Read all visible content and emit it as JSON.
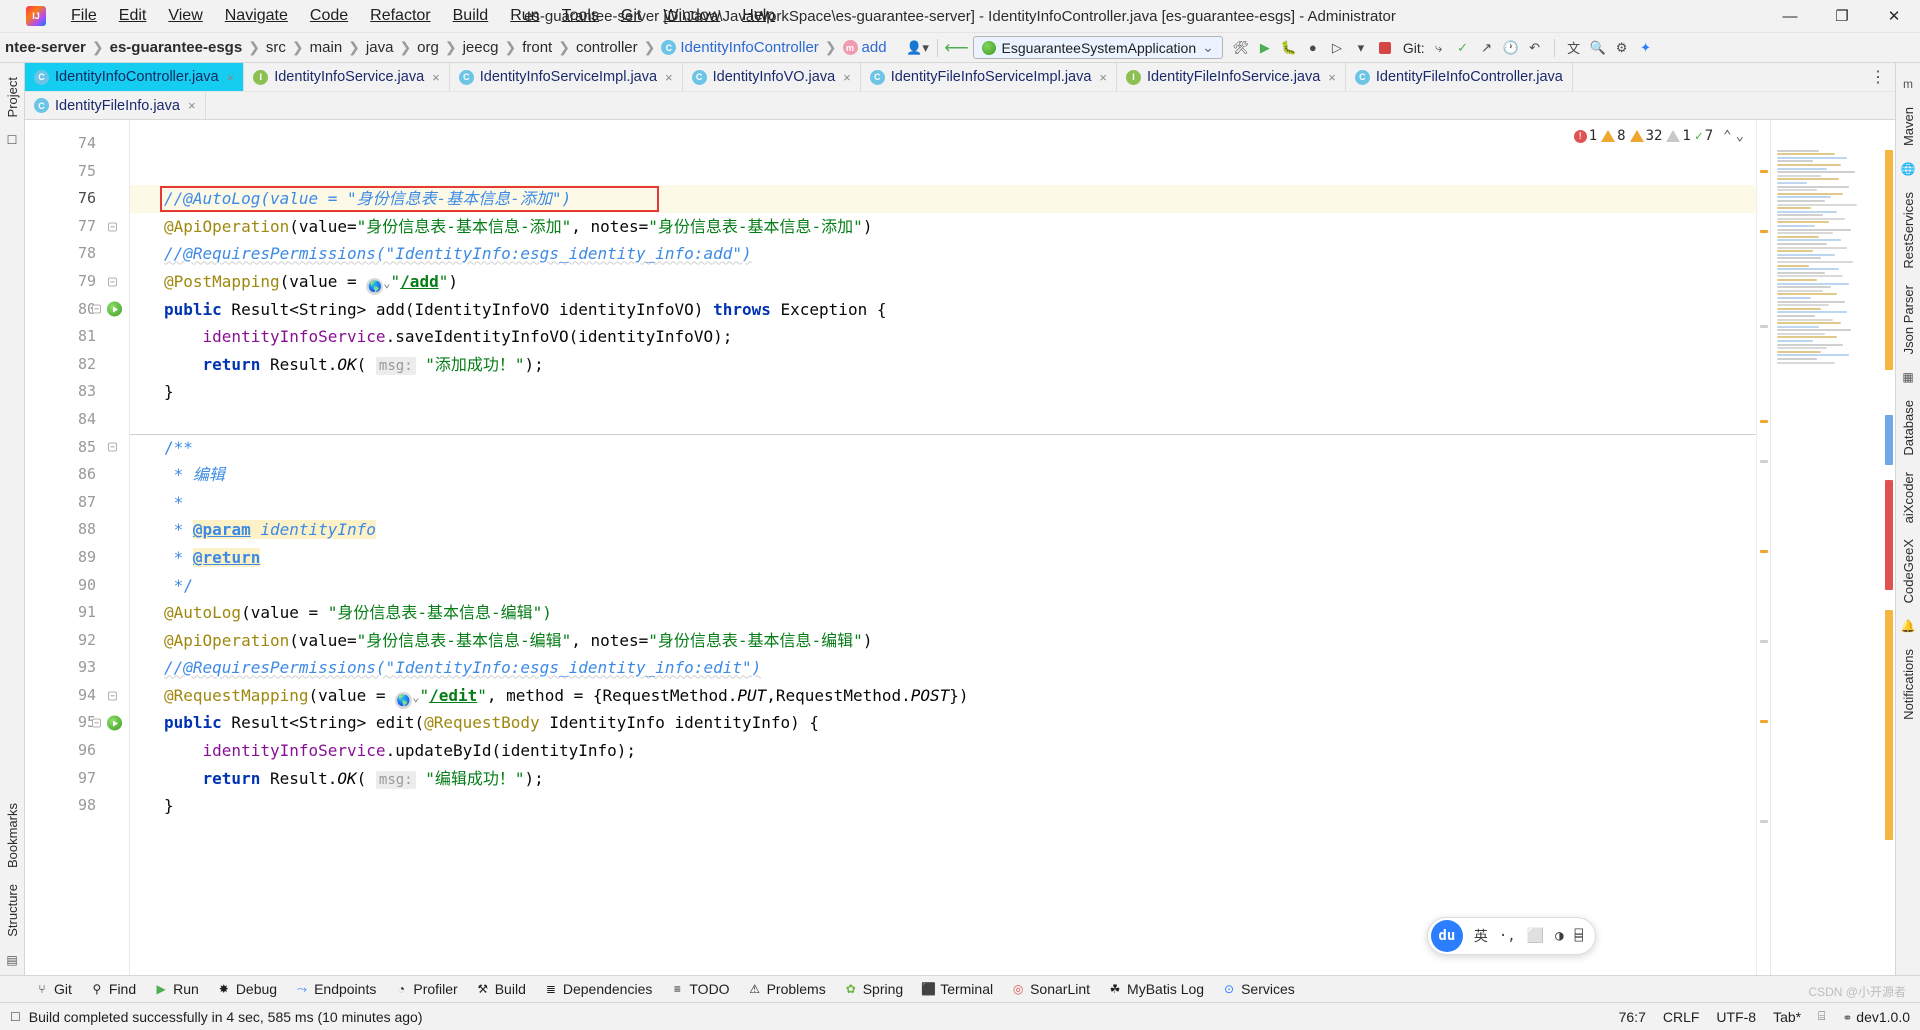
{
  "window": {
    "title": "es-guarantee-server [D:\\Java\\JavaWorkSpace\\es-guarantee-server] - IdentityInfoController.java [es-guarantee-esgs] - Administrator",
    "logo_label": "IJ",
    "minimize": "—",
    "maximize": "❐",
    "close": "✕"
  },
  "menubar": {
    "items": [
      {
        "label": "File"
      },
      {
        "label": "Edit"
      },
      {
        "label": "View"
      },
      {
        "label": "Navigate"
      },
      {
        "label": "Code"
      },
      {
        "label": "Refactor"
      },
      {
        "label": "Build"
      },
      {
        "label": "Run"
      },
      {
        "label": "Tools"
      },
      {
        "label": "Git"
      },
      {
        "label": "Window"
      },
      {
        "label": "Help"
      }
    ]
  },
  "navbar": {
    "crumbs": [
      {
        "label": "ntee-server",
        "bold": true,
        "icon": ""
      },
      {
        "label": "es-guarantee-esgs",
        "bold": true,
        "icon": ""
      },
      {
        "label": "src",
        "bold": false,
        "icon": ""
      },
      {
        "label": "main",
        "bold": false,
        "icon": ""
      },
      {
        "label": "java",
        "bold": false,
        "icon": ""
      },
      {
        "label": "org",
        "bold": false,
        "icon": ""
      },
      {
        "label": "jeecg",
        "bold": false,
        "icon": ""
      },
      {
        "label": "front",
        "bold": false,
        "icon": ""
      },
      {
        "label": "controller",
        "bold": false,
        "icon": ""
      },
      {
        "label": "IdentityInfoController",
        "bold": false,
        "icon": "class-icon",
        "icon_letter": "C"
      },
      {
        "label": "add",
        "bold": false,
        "icon": "method-icon",
        "icon_letter": "m"
      }
    ],
    "separator": "❯",
    "run_config": "EsguaranteeSystemApplication",
    "run_config_caret": "⌄",
    "git_label": "Git:"
  },
  "tabs": [
    {
      "label": "IdentityInfoController.java",
      "icon": "class-icon",
      "letter": "C",
      "active": true
    },
    {
      "label": "IdentityInfoService.java",
      "icon": "interface-icon",
      "letter": "I",
      "active": false
    },
    {
      "label": "IdentityInfoServiceImpl.java",
      "icon": "class-icon",
      "letter": "C",
      "active": false
    },
    {
      "label": "IdentityInfoVO.java",
      "icon": "class-icon",
      "letter": "C",
      "active": false
    },
    {
      "label": "IdentityFileInfoServiceImpl.java",
      "icon": "class-icon",
      "letter": "C",
      "active": false
    },
    {
      "label": "IdentityFileInfoService.java",
      "icon": "interface-icon",
      "letter": "I",
      "active": false
    },
    {
      "label": "IdentityFileInfoController.java",
      "icon": "class-icon",
      "letter": "C",
      "active": false
    }
  ],
  "tabs_row2": [
    {
      "label": "IdentityFileInfo.java",
      "icon": "class-icon",
      "letter": "C",
      "active": false
    }
  ],
  "tab_close_glyph": "×",
  "tabs_more_glyph": "⋮",
  "inspections": {
    "errors": "1",
    "warnings": "8",
    "weak_warnings": "32",
    "infos": "1",
    "typos": "7",
    "up_glyph": "⌃",
    "down_glyph": "⌄"
  },
  "editor": {
    "first_line": 74,
    "current_line": 76,
    "lines": [
      {
        "n": 74,
        "text": ""
      },
      {
        "n": 75,
        "text": ""
      },
      {
        "n": 76,
        "text": "//@AutoLog(value = \"身份信息表-基本信息-添加\")"
      },
      {
        "n": 77,
        "text": "@ApiOperation(value=\"身份信息表-基本信息-添加\", notes=\"身份信息表-基本信息-添加\")"
      },
      {
        "n": 78,
        "text": "//@RequiresPermissions(\"IdentityInfo:esgs_identity_info:add\")"
      },
      {
        "n": 79,
        "text": "@PostMapping(value = \"/add\")"
      },
      {
        "n": 80,
        "text": "public Result<String> add(IdentityInfoVO identityInfoVO) throws Exception {"
      },
      {
        "n": 81,
        "text": "    identityInfoService.saveIdentityInfoVO(identityInfoVO);"
      },
      {
        "n": 82,
        "text": "    return Result.OK( msg: \"添加成功！\");"
      },
      {
        "n": 83,
        "text": "}"
      },
      {
        "n": 84,
        "text": ""
      },
      {
        "n": 85,
        "text": "/**"
      },
      {
        "n": 86,
        "text": " * 编辑"
      },
      {
        "n": 87,
        "text": " *"
      },
      {
        "n": 88,
        "text": " * @param identityInfo"
      },
      {
        "n": 89,
        "text": " * @return"
      },
      {
        "n": 90,
        "text": " */"
      },
      {
        "n": 91,
        "text": "@AutoLog(value = \"身份信息表-基本信息-编辑\")"
      },
      {
        "n": 92,
        "text": "@ApiOperation(value=\"身份信息表-基本信息-编辑\", notes=\"身份信息表-基本信息-编辑\")"
      },
      {
        "n": 93,
        "text": "//@RequiresPermissions(\"IdentityInfo:esgs_identity_info:edit\")"
      },
      {
        "n": 94,
        "text": "@RequestMapping(value = \"/edit\", method = {RequestMethod.PUT,RequestMethod.POST})"
      },
      {
        "n": 95,
        "text": "public Result<String> edit(@RequestBody IdentityInfo identityInfo) {"
      },
      {
        "n": 96,
        "text": "    identityInfoService.updateById(identityInfo);"
      },
      {
        "n": 97,
        "text": "    return Result.OK( msg: \"编辑成功！\");"
      },
      {
        "n": 98,
        "text": "}"
      }
    ],
    "tokens": {
      "autolog_comment_prefix": "//@AutoLog(value = ",
      "autolog_comment_string": "\"身份信息表-基本信息-添加\")",
      "api_operation_name": "@ApiOperation",
      "api_value_key": "value=",
      "api_value_str": "\"身份信息表-基本信息-添加\"",
      "api_notes_key": "notes=",
      "api_notes_str": "\"身份信息表-基本信息-添加\"",
      "requires_permissions_add": "//@RequiresPermissions(\"IdentityInfo:esgs_identity_info:add\")",
      "post_mapping": "@PostMapping",
      "value_eq": "(value = ",
      "add_path": "\"/add\"",
      "add_path_inner": "/add",
      "kw_public": "public",
      "result_string": " Result<String> ",
      "method_add": "add(IdentityInfoVO identityInfoVO) ",
      "kw_throws": "throws",
      "exception_brace": " Exception {",
      "service_field": "identityInfoService",
      "save_call": ".saveIdentityInfoVO(identityInfoVO);",
      "kw_return": "return",
      "result_ok": " Result.",
      "ok_static": "OK",
      "paren_open": "( ",
      "msg_hint": "msg:",
      "add_success_str": " \"添加成功！\"",
      "semi_close": ");",
      "brace_close": "}",
      "jdoc_open": "/**",
      "jdoc_star": " *",
      "jdoc_edit": " 编辑",
      "jdoc_param_tag": "@param",
      "jdoc_param_name": " identityInfo",
      "jdoc_return_tag": "@return",
      "jdoc_close": " */",
      "autolog_name": "@AutoLog",
      "autolog_edit_str": "\"身份信息表-基本信息-编辑\")",
      "api_value_str_edit": "\"身份信息表-基本信息-编辑\"",
      "api_notes_str_edit": "\"身份信息表-基本信息-编辑\"",
      "requires_permissions_edit": "//@RequiresPermissions(\"IdentityInfo:esgs_identity_info:edit\")",
      "request_mapping": "@RequestMapping",
      "edit_path": "\"/edit\"",
      "edit_path_inner": "/edit",
      "method_eq": ", method = {RequestMethod.",
      "http_put": "PUT",
      "request_method2": ",RequestMethod.",
      "http_post": "POST",
      "close_brace_paren": "})",
      "method_edit": "edit(",
      "request_body": "@RequestBody",
      "identity_info_param": " IdentityInfo identityInfo) {",
      "update_call": ".updateById(identityInfo);",
      "edit_success_str": " \"编辑成功！\""
    }
  },
  "left_strip": {
    "project": "Project",
    "structure": "Structure",
    "bookmarks": "Bookmarks"
  },
  "right_strip": {
    "items": [
      "Maven",
      "RestServices",
      "Json Parser",
      "Database",
      "aiXcoder",
      "CodeGeeX",
      "Notifications"
    ]
  },
  "ime": {
    "logo": "du",
    "lang": "英",
    "dot": "·,",
    "screen": "⬜",
    "user": "◑",
    "grid": "⌸"
  },
  "bottom_tools": [
    {
      "label": "Git",
      "icon": "branch-icon",
      "glyph": "⑂"
    },
    {
      "label": "Find",
      "icon": "search-icon",
      "glyph": "⚲"
    },
    {
      "label": "Run",
      "icon": "play-icon",
      "glyph": "▶"
    },
    {
      "label": "Debug",
      "icon": "bug-icon",
      "glyph": "✸"
    },
    {
      "label": "Endpoints",
      "icon": "endpoints-icon",
      "glyph": "⤳"
    },
    {
      "label": "Profiler",
      "icon": "profiler-icon",
      "glyph": "◔"
    },
    {
      "label": "Build",
      "icon": "hammer-icon",
      "glyph": "⚒"
    },
    {
      "label": "Dependencies",
      "icon": "dependencies-icon",
      "glyph": "≣"
    },
    {
      "label": "TODO",
      "icon": "todo-icon",
      "glyph": "≡"
    },
    {
      "label": "Problems",
      "icon": "problems-icon",
      "glyph": "⚠"
    },
    {
      "label": "Spring",
      "icon": "spring-icon",
      "glyph": "✿"
    },
    {
      "label": "Terminal",
      "icon": "terminal-icon",
      "glyph": "⬛"
    },
    {
      "label": "SonarLint",
      "icon": "sonarlint-icon",
      "glyph": "◎"
    },
    {
      "label": "MyBatis Log",
      "icon": "mybatis-icon",
      "glyph": "☘"
    },
    {
      "label": "Services",
      "icon": "services-icon",
      "glyph": "⊙"
    }
  ],
  "statusbar": {
    "message": "Build completed successfully in 4 sec, 585 ms (10 minutes ago)",
    "message_icon": "notification-icon",
    "caret_position": "76:7",
    "line_separator": "CRLF",
    "encoding": "UTF-8",
    "indent": "Tab*",
    "branch": "dev1.0.0",
    "branch_icon": "branch-icon",
    "lock_icon": "⌸"
  },
  "watermark": "CSDN @小开源者",
  "colors": {
    "accent": "#15cdf0",
    "highlight_box": "#e53935",
    "current_line": "#fcfae7",
    "string": "#067d17",
    "keyword": "#0033b3",
    "annotation": "#9e880d",
    "comment": "#8c8c8c",
    "javadoc": "#3d8ae5",
    "field": "#871094"
  }
}
